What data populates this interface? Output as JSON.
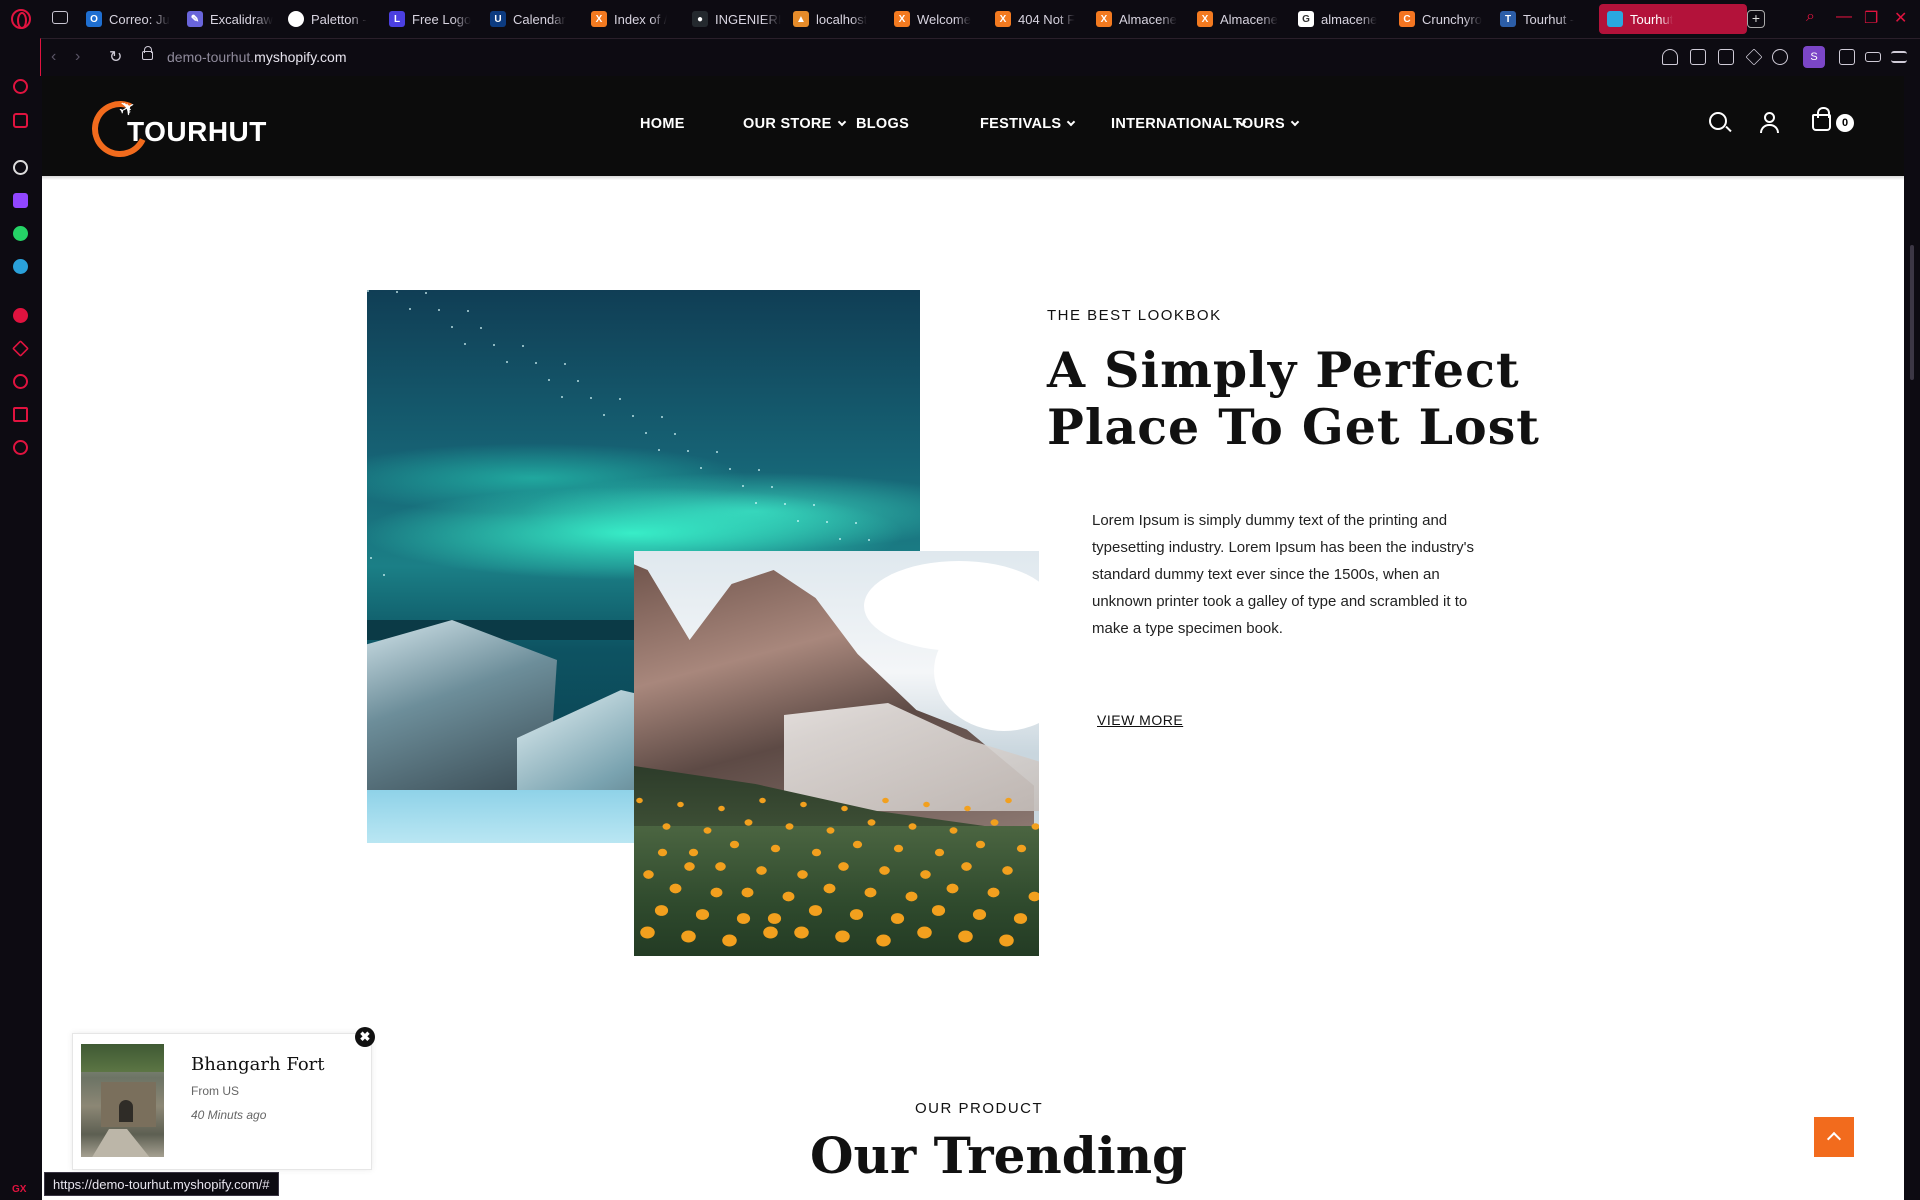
{
  "browser": {
    "tabs": [
      {
        "label": "Correo: Ju",
        "icon": "outlook-icon",
        "color": "#1f6fd1",
        "glyph": "O"
      },
      {
        "label": "Excalidraw",
        "icon": "excalidraw-icon",
        "color": "#6965db",
        "glyph": "✎"
      },
      {
        "label": "Paletton -",
        "icon": "paletton-icon",
        "color": "#ffffff",
        "glyph": ""
      },
      {
        "label": "Free Logo",
        "icon": "logo-maker-icon",
        "color": "#4b3fe0",
        "glyph": "L"
      },
      {
        "label": "Calendar",
        "icon": "calendar-icon",
        "color": "#0c3b80",
        "glyph": "U"
      },
      {
        "label": "Index of /",
        "icon": "xampp-icon",
        "color": "#f37a20",
        "glyph": "X"
      },
      {
        "label": "INGENIERI",
        "icon": "github-icon",
        "color": "#24292e",
        "glyph": "●"
      },
      {
        "label": "localhost",
        "icon": "phpmyadmin-icon",
        "color": "#e58b2a",
        "glyph": "▲"
      },
      {
        "label": "Welcome",
        "icon": "xampp-icon",
        "color": "#f37a20",
        "glyph": "X"
      },
      {
        "label": "404 Not F",
        "icon": "xampp-icon",
        "color": "#f37a20",
        "glyph": "X"
      },
      {
        "label": "Almacene",
        "icon": "xampp-icon",
        "color": "#f37a20",
        "glyph": "X"
      },
      {
        "label": "Almacene",
        "icon": "xampp-icon",
        "color": "#f37a20",
        "glyph": "X"
      },
      {
        "label": "almacene",
        "icon": "google-icon",
        "color": "#ffffff",
        "glyph": "G"
      },
      {
        "label": "Crunchyro",
        "icon": "crunchyroll-icon",
        "color": "#f47521",
        "glyph": "C"
      },
      {
        "label": "Tourhut -",
        "icon": "tourhut-icon",
        "color": "#2c5ea8",
        "glyph": "T"
      }
    ],
    "active_tab": {
      "label": "Tourhut",
      "icon": "shopify-icon",
      "color": "#2aa8e0"
    },
    "new_tab_label": "+",
    "url_host": "demo-tourhut.",
    "url_domain": "myshopify.com",
    "profile_initial": "S",
    "status_url": "https://demo-tourhut.myshopify.com/#",
    "accent": "#e0133f",
    "gx_label": "GX"
  },
  "site": {
    "logo_text": "TOURHUT",
    "nav": [
      {
        "label": "HOME",
        "dropdown": false
      },
      {
        "label": "OUR STORE",
        "dropdown": true
      },
      {
        "label": "BLOGS",
        "dropdown": false
      },
      {
        "label": "FESTIVALS",
        "dropdown": true
      },
      {
        "label": "INTERNATIONAL",
        "dropdown": true
      },
      {
        "label": "TOURS",
        "dropdown": true
      }
    ],
    "cart_count": "0",
    "brand_color": "#f26b1d"
  },
  "lookbook": {
    "eyebrow": "THE BEST LOOKBOK",
    "heading": "A Simply Perfect Place To Get Lost",
    "body": "Lorem Ipsum is simply dummy text of the printing and typesetting industry. Lorem Ipsum has been the industry's standard dummy text ever since the 1500s, when an unknown printer took a galley of type and scrambled it to make a type specimen book.",
    "link": "VIEW MORE"
  },
  "products": {
    "eyebrow": "OUR PRODUCT",
    "heading": "Our Trending"
  },
  "sales_popup": {
    "title": "Bhangarh Fort",
    "from": "From US",
    "time": "40 Minuts ago",
    "close_glyph": "✖"
  }
}
